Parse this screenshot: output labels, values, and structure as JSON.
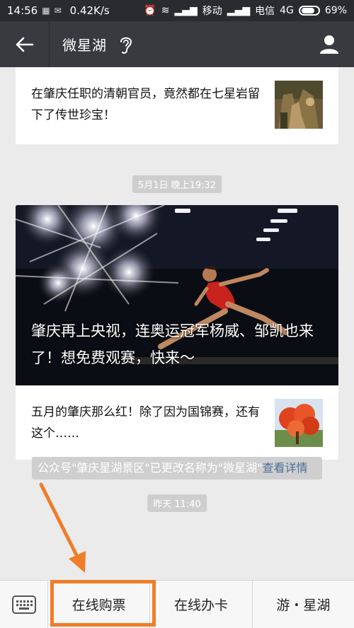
{
  "status_bar": {
    "time": "14:56",
    "speed": "0.42K/s",
    "carrier1": "移动",
    "carrier2": "电信",
    "network": "4G",
    "battery": "69%"
  },
  "nav": {
    "title": "微星湖"
  },
  "messages": {
    "article1": "在肇庆任职的清朝官员，竟然都在七星岩留下了传世珍宝！",
    "timestamp1": "5月1日 晚上19:32",
    "hero_caption": "肇庆再上央视，连奥运冠军杨威、邹凯也来了！想免费观赛，快来～",
    "article2": "五月的肇庆那么红！除了因为国锦赛，还有这个……",
    "timestamp2": "昨天 11:40",
    "system_msg": "公众号\"肇庆星湖景区\"已更改名称为\"微星湖\"",
    "system_link": "查看详情"
  },
  "bottom_menu": {
    "item1": "在线购票",
    "item2": "在线办卡",
    "item3": "游・星湖"
  },
  "colors": {
    "highlight": "#f07d2a",
    "nav_bg": "#393a3f",
    "link": "#4a6f9b"
  }
}
